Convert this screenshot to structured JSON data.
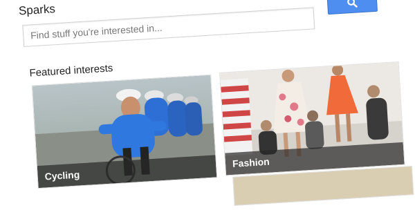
{
  "app": {
    "title": "Sparks"
  },
  "search": {
    "placeholder": "Find stuff you're interested in...",
    "button_icon": "search-icon"
  },
  "featured": {
    "heading": "Featured interests",
    "cards": [
      {
        "label": "Cycling"
      },
      {
        "label": "Fashion"
      }
    ]
  },
  "colors": {
    "accent": "#4d8ef0",
    "label_band": "#282828"
  }
}
